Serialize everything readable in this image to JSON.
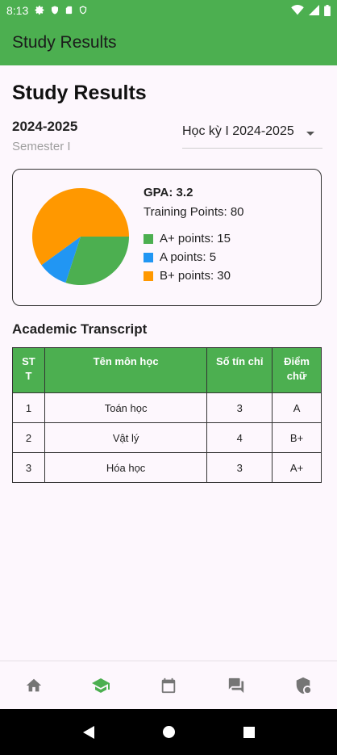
{
  "status_bar": {
    "time": "8:13"
  },
  "app_bar": {
    "title": "Study Results"
  },
  "page": {
    "title": "Study Results",
    "year": "2024-2025",
    "semester": "Semester I",
    "dropdown_value": "Học kỳ I 2024-2025"
  },
  "summary": {
    "gpa": "GPA: 3.2",
    "training_points": "Training Points: 80",
    "legend": [
      {
        "label": "A+ points: 15",
        "color": "#4caf50"
      },
      {
        "label": "A points: 5",
        "color": "#2196f3"
      },
      {
        "label": "B+ points: 30",
        "color": "#ff9800"
      }
    ]
  },
  "chart_data": {
    "type": "pie",
    "slices": [
      {
        "label": "A+ points",
        "value": 15,
        "color": "#4caf50"
      },
      {
        "label": "A points",
        "value": 5,
        "color": "#2196f3"
      },
      {
        "label": "B+ points",
        "value": 30,
        "color": "#ff9800"
      }
    ]
  },
  "transcript": {
    "title": "Academic Transcript",
    "headers": [
      "STT",
      "Tên môn học",
      "Số tín chỉ",
      "Điểm chữ"
    ],
    "rows": [
      [
        "1",
        "Toán học",
        "3",
        "A"
      ],
      [
        "2",
        "Vật lý",
        "4",
        "B+"
      ],
      [
        "3",
        "Hóa học",
        "3",
        "A+"
      ]
    ]
  },
  "bottom_nav": {
    "items": [
      {
        "icon": "home-icon",
        "active": false
      },
      {
        "icon": "school-icon",
        "active": true
      },
      {
        "icon": "calendar-icon",
        "active": false
      },
      {
        "icon": "chat-icon",
        "active": false
      },
      {
        "icon": "shield-account-icon",
        "active": false
      }
    ],
    "active_color": "#4caf50",
    "inactive_color": "#757575"
  }
}
